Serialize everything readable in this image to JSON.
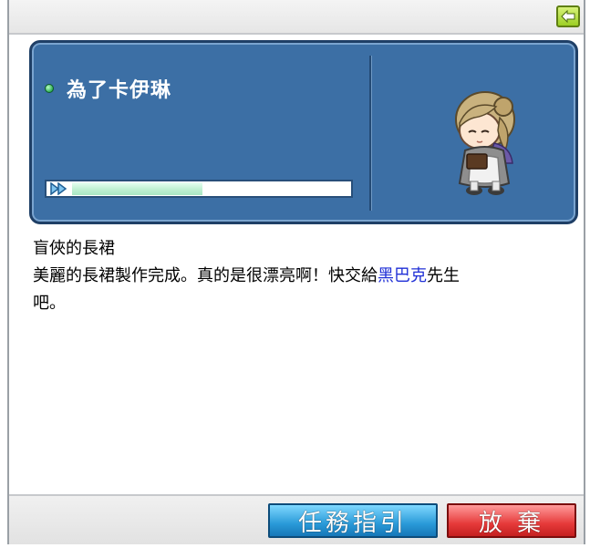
{
  "quest": {
    "title": "為了卡伊琳",
    "progress": 0.47
  },
  "description": {
    "item_name": "盲俠的長裙",
    "line2_pre": "美麗的長裙製作完成。真的是很漂亮啊！快交給",
    "npc_name": "黑巴克",
    "line2_post": "先生",
    "line3": "吧。"
  },
  "buttons": {
    "guide_label": "任務指引",
    "abandon_label": "放 棄"
  },
  "colors": {
    "panel": "#3c6fa5",
    "npc_highlight": "#1f2fd6"
  }
}
